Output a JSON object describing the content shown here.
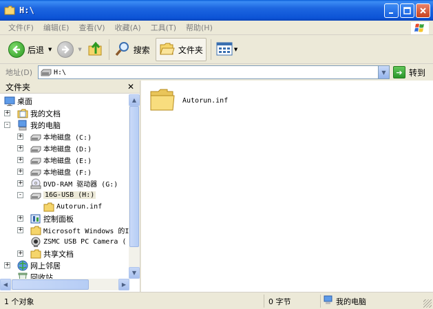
{
  "window": {
    "title": "H:\\",
    "buttons": [
      "minimize",
      "maximize",
      "close"
    ]
  },
  "menu": [
    {
      "label": "文件(F)"
    },
    {
      "label": "编辑(E)"
    },
    {
      "label": "查看(V)"
    },
    {
      "label": "收藏(A)"
    },
    {
      "label": "工具(T)"
    },
    {
      "label": "帮助(H)"
    }
  ],
  "toolbar": {
    "back_label": "后退",
    "search_label": "搜索",
    "folders_label": "文件夹"
  },
  "address": {
    "label": "地址(D)",
    "value": "H:\\",
    "go_label": "转到"
  },
  "left_pane": {
    "title": "文件夹",
    "tree": [
      {
        "label": "桌面",
        "icon": "desktop-icon",
        "expander": "",
        "level": 0
      },
      {
        "label": "我的文档",
        "icon": "my-documents-icon",
        "expander": "+",
        "level": 1
      },
      {
        "label": "我的电脑",
        "icon": "my-computer-icon",
        "expander": "-",
        "level": 1
      },
      {
        "label": "本地磁盘 (C:)",
        "icon": "local-disk-icon",
        "expander": "+",
        "level": 2
      },
      {
        "label": "本地磁盘 (D:)",
        "icon": "local-disk-icon",
        "expander": "+",
        "level": 2
      },
      {
        "label": "本地磁盘 (E:)",
        "icon": "local-disk-icon",
        "expander": "+",
        "level": 2
      },
      {
        "label": "本地磁盘 (F:)",
        "icon": "local-disk-icon",
        "expander": "+",
        "level": 2
      },
      {
        "label": "DVD-RAM 驱动器 (G:)",
        "icon": "dvd-drive-icon",
        "expander": "+",
        "level": 2
      },
      {
        "label": "16G-USB (H:)",
        "icon": "usb-drive-icon",
        "expander": "-",
        "level": 2
      },
      {
        "label": "Autorun.inf",
        "icon": "folder-icon",
        "expander": "",
        "level": 3
      },
      {
        "label": "控制面板",
        "icon": "control-panel-icon",
        "expander": "+",
        "level": 2
      },
      {
        "label": "Microsoft Windows 的I",
        "icon": "folder-icon",
        "expander": "+",
        "level": 2
      },
      {
        "label": "ZSMC USB PC Camera (",
        "icon": "camera-icon",
        "expander": "",
        "level": 2
      },
      {
        "label": "共享文档",
        "icon": "folder-icon",
        "expander": "+",
        "level": 2
      },
      {
        "label": "网上邻居",
        "icon": "network-icon",
        "expander": "+",
        "level": 1
      },
      {
        "label": "回收站",
        "icon": "recycle-bin-icon",
        "expander": "",
        "level": 1
      }
    ]
  },
  "right_pane": {
    "items": [
      {
        "name": "Autorun.inf",
        "icon": "folder-icon"
      }
    ]
  },
  "status": {
    "objects": "1 个对象",
    "size": "0 字节",
    "location": "我的电脑"
  },
  "colors": {
    "titlebar": "#0A5FD8",
    "window_bg": "#ECE9D8",
    "folder": "#F5D56B"
  }
}
